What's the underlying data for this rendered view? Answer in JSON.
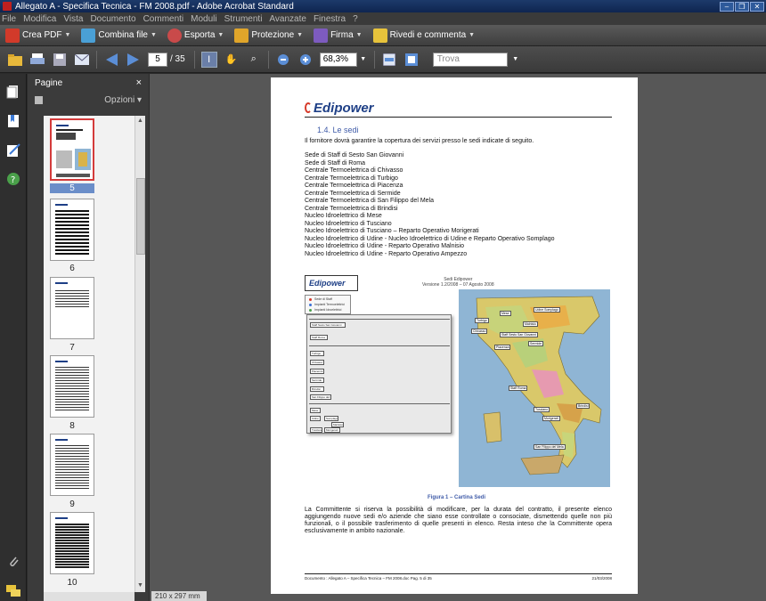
{
  "window": {
    "title": "Allegato A - Specifica Tecnica - FM 2008.pdf - Adobe Acrobat Standard"
  },
  "menu": [
    "File",
    "Modifica",
    "Vista",
    "Documento",
    "Commenti",
    "Moduli",
    "Strumenti",
    "Avanzate",
    "Finestra",
    "?"
  ],
  "tasks": [
    {
      "label": "Crea PDF",
      "color": "#d23a2a"
    },
    {
      "label": "Combina file",
      "color": "#4aa0d6"
    },
    {
      "label": "Esporta",
      "color": "#c94a4a"
    },
    {
      "label": "Protezione",
      "color": "#e0a52a"
    },
    {
      "label": "Firma",
      "color": "#7d5bbf"
    },
    {
      "label": "Rivedi e commenta",
      "color": "#e7c33b"
    }
  ],
  "nav": {
    "page_value": "5",
    "page_total": "/ 35",
    "zoom": "68,3%",
    "find_placeholder": "Trova"
  },
  "panel": {
    "title": "Pagine",
    "options": "Opzioni"
  },
  "thumbs": [
    "5",
    "6",
    "7",
    "8",
    "9",
    "10"
  ],
  "status": {
    "size": "210 x 297 mm"
  },
  "document": {
    "logo": "Edipower",
    "section": "1.4. Le sedi",
    "intro": "Il fornitore dovrà garantire la copertura dei servizi presso le sedi indicate di seguito.",
    "sites": [
      "Sede di Staff di Sesto San Giovanni",
      "Sede di Staff di Roma",
      "Centrale Termoelettrica di Chivasso",
      "Centrale Termoelettrica di Turbigo",
      "Centrale Termoelettrica di Piacenza",
      "Centrale Termoelettrica di Sermide",
      "Centrale Termoelettrica di San Filippo del Mela",
      "Centrale Termoelettrica di Brindisi",
      "Nucleo Idroelettrico di Mese",
      "Nucleo Idroelettrico di Tusciano",
      "Nucleo Idroelettrico di Tusciano – Reparto Operativo Morigerati",
      "Nucleo Idroelettrico di Udine - Nucleo Idroelettrico di Udine e Reparto Operativo Somplago",
      "Nucleo Idroelettrico di Udine - Reparto Operativo Malnisio",
      "Nucleo Idroelettrico di Udine - Reparto Operativo Ampezzo"
    ],
    "figure": {
      "title_line1": "Sedi Edipower",
      "title_line2": "Versione 1.2/2008 – 07 Agosto 2008",
      "legend": [
        "Sede di Staff",
        "Impianti Termoelettrici",
        "Impianti Idroelettrici"
      ],
      "org_boxes": [
        "Staff Sesto San Giovanni",
        "Staff Roma",
        "Turbigo",
        "Chivasso",
        "Piacenza",
        "Sermide",
        "Brindisi",
        "San Filippo del Mela",
        "Mese",
        "Udine",
        "Somplago",
        "Malnisio",
        "Tusciano",
        "Morigerati"
      ],
      "map_labels": [
        "Udine Somplago",
        "Mese",
        "Malnisio",
        "Chivasso",
        "Turbigo",
        "Staff Sesto San Giovanni",
        "Sermide",
        "Piacenza",
        "Staff Roma",
        "Tusciano",
        "Morigerati",
        "Brindisi",
        "San Filippo del Mela"
      ],
      "caption": "Figura 1 – Cartina Sedi"
    },
    "paragraph": "La Committente si riserva la possibilità di modificare, per la durata del contratto, il presente elenco aggiungendo nuove sedi e/o aziende che siano esse controllate o consociate, dismettendo quelle non più funzionali, o il possibile trasferimento di quelle presenti in elenco. Resta inteso che la Committente opera esclusivamente in ambito nazionale.",
    "footer_left": "Documento : Allegato A – Specifica Tecnica – FM 2008.doc     Pag. 5 di 35",
    "footer_right": "21/03/2008"
  }
}
